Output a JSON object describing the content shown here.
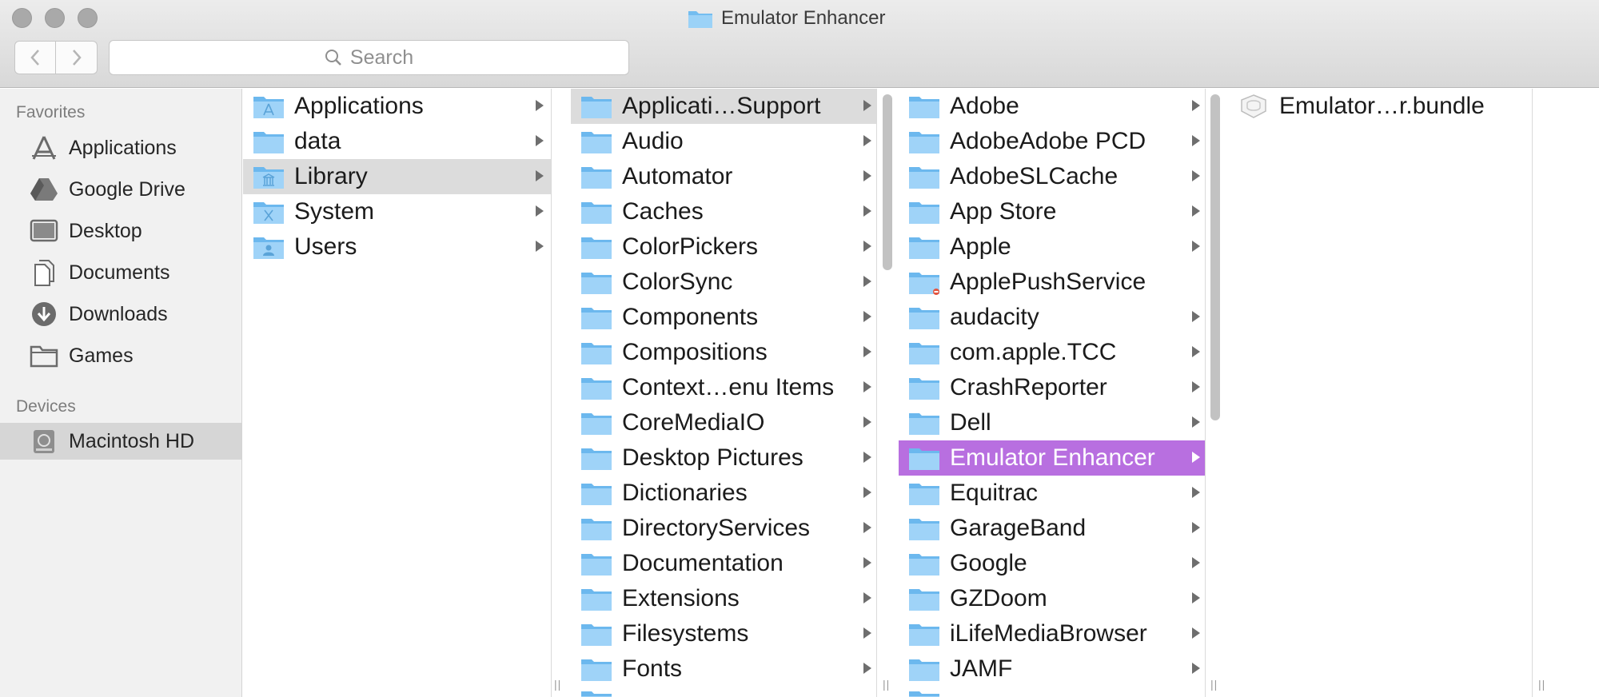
{
  "window": {
    "title": "Emulator Enhancer"
  },
  "toolbar": {
    "search_placeholder": "Search"
  },
  "sidebar": {
    "favorites_header": "Favorites",
    "favorites": [
      {
        "label": "Applications",
        "icon": "applications-icon"
      },
      {
        "label": "Google Drive",
        "icon": "google-drive-icon"
      },
      {
        "label": "Desktop",
        "icon": "desktop-icon"
      },
      {
        "label": "Documents",
        "icon": "documents-icon"
      },
      {
        "label": "Downloads",
        "icon": "downloads-icon"
      },
      {
        "label": "Games",
        "icon": "folder-icon"
      }
    ],
    "devices_header": "Devices",
    "devices": [
      {
        "label": "Macintosh HD",
        "icon": "hard-drive-icon",
        "selected": true
      }
    ]
  },
  "columns": [
    {
      "items": [
        {
          "label": "Applications",
          "icon": "applications-folder-icon"
        },
        {
          "label": "data",
          "icon": "folder-icon"
        },
        {
          "label": "Library",
          "icon": "library-folder-icon",
          "selected": true
        },
        {
          "label": "System",
          "icon": "system-folder-icon"
        },
        {
          "label": "Users",
          "icon": "users-folder-icon"
        }
      ]
    },
    {
      "items": [
        {
          "label": "Applicati…Support",
          "selected": true
        },
        {
          "label": "Audio"
        },
        {
          "label": "Automator"
        },
        {
          "label": "Caches"
        },
        {
          "label": "ColorPickers"
        },
        {
          "label": "ColorSync"
        },
        {
          "label": "Components"
        },
        {
          "label": "Compositions"
        },
        {
          "label": "Context…enu Items"
        },
        {
          "label": "CoreMediaIO"
        },
        {
          "label": "Desktop Pictures"
        },
        {
          "label": "Dictionaries"
        },
        {
          "label": "DirectoryServices"
        },
        {
          "label": "Documentation"
        },
        {
          "label": "Extensions"
        },
        {
          "label": "Filesystems"
        },
        {
          "label": "Fonts"
        }
      ]
    },
    {
      "items": [
        {
          "label": "Adobe"
        },
        {
          "label": "AdobeAdobe PCD"
        },
        {
          "label": "AdobeSLCache"
        },
        {
          "label": "App Store"
        },
        {
          "label": "Apple"
        },
        {
          "label": "ApplePushService",
          "restricted": true
        },
        {
          "label": "audacity"
        },
        {
          "label": "com.apple.TCC"
        },
        {
          "label": "CrashReporter"
        },
        {
          "label": "Dell"
        },
        {
          "label": "Emulator Enhancer",
          "selected": true
        },
        {
          "label": "Equitrac"
        },
        {
          "label": "GarageBand"
        },
        {
          "label": "Google"
        },
        {
          "label": "GZDoom"
        },
        {
          "label": "iLifeMediaBrowser"
        },
        {
          "label": "JAMF"
        }
      ]
    },
    {
      "items": [
        {
          "label": "Emulator…r.bundle",
          "icon": "bundle-icon"
        }
      ]
    }
  ],
  "colors": {
    "selection_purple": "#b86fe0",
    "selection_gray": "#dcdcdc",
    "folder_blue": "#7cc4f4"
  }
}
